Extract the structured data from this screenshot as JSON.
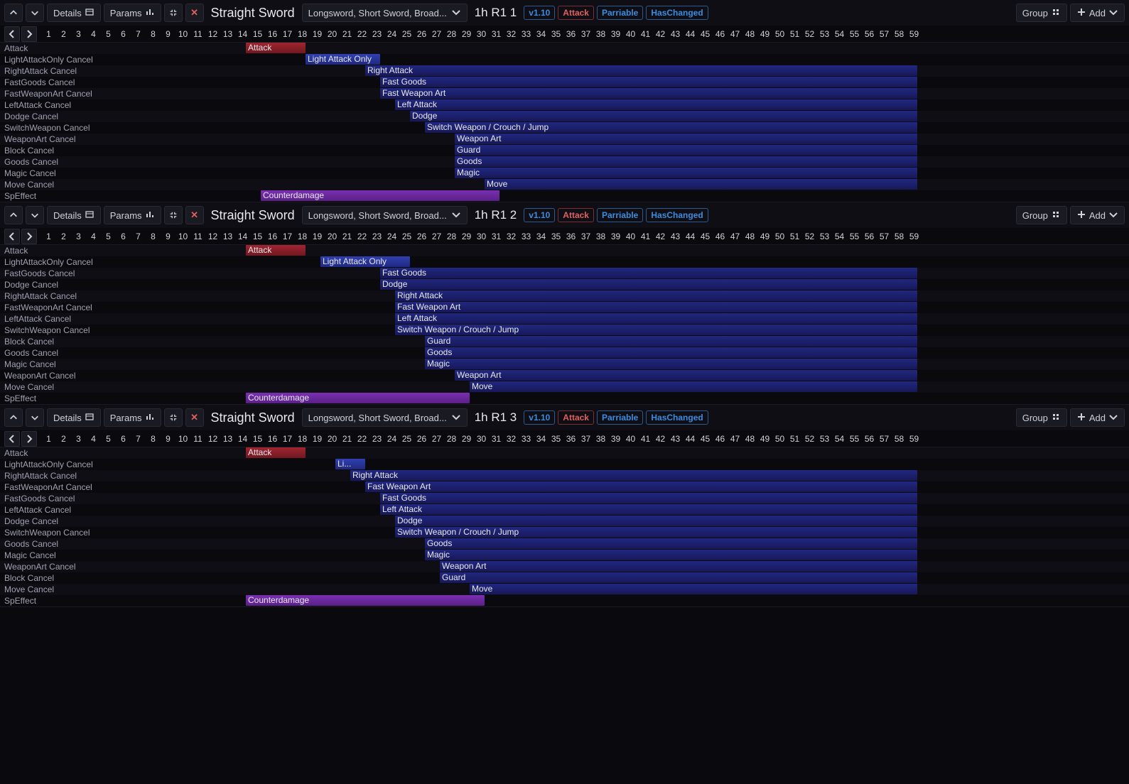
{
  "common": {
    "details_label": "Details",
    "params_label": "Params",
    "group_label": "Group",
    "add_label": "Add",
    "weapon_category": "Straight Sword",
    "weapon_list": "Longsword, Short Sword, Broad...",
    "version_tag": "v1.10",
    "attack_tag": "Attack",
    "parriable_tag": "Parriable",
    "changed_tag": "HasChanged"
  },
  "chart_data": [
    {
      "type": "bar",
      "title": "1h R1 1",
      "x_range": [
        1,
        59
      ],
      "tracks": [
        {
          "label": "Attack",
          "start": 15,
          "end": 18,
          "text": "Attack",
          "color": "red"
        },
        {
          "label": "LightAttackOnly Cancel",
          "start": 19,
          "end": 23,
          "text": "Light Attack Only",
          "color": "blue-light"
        },
        {
          "label": "RightAttack Cancel",
          "start": 23,
          "end": 59,
          "text": "Right Attack",
          "color": "blue"
        },
        {
          "label": "FastGoods Cancel",
          "start": 24,
          "end": 59,
          "text": "Fast Goods",
          "color": "blue"
        },
        {
          "label": "FastWeaponArt Cancel",
          "start": 24,
          "end": 59,
          "text": "Fast Weapon Art",
          "color": "blue"
        },
        {
          "label": "LeftAttack Cancel",
          "start": 25,
          "end": 59,
          "text": "Left Attack",
          "color": "blue"
        },
        {
          "label": "Dodge Cancel",
          "start": 26,
          "end": 59,
          "text": "Dodge",
          "color": "blue"
        },
        {
          "label": "SwitchWeapon Cancel",
          "start": 27,
          "end": 59,
          "text": "Switch Weapon / Crouch / Jump",
          "color": "blue"
        },
        {
          "label": "WeaponArt Cancel",
          "start": 29,
          "end": 59,
          "text": "Weapon Art",
          "color": "blue"
        },
        {
          "label": "Block Cancel",
          "start": 29,
          "end": 59,
          "text": "Guard",
          "color": "blue"
        },
        {
          "label": "Goods Cancel",
          "start": 29,
          "end": 59,
          "text": "Goods",
          "color": "blue"
        },
        {
          "label": "Magic Cancel",
          "start": 29,
          "end": 59,
          "text": "Magic",
          "color": "blue"
        },
        {
          "label": "Move Cancel",
          "start": 31,
          "end": 59,
          "text": "Move",
          "color": "blue"
        },
        {
          "label": "SpEffect",
          "start": 16,
          "end": 31,
          "text": "Counterdamage",
          "color": "purple"
        }
      ]
    },
    {
      "type": "bar",
      "title": "1h R1 2",
      "x_range": [
        1,
        59
      ],
      "tracks": [
        {
          "label": "Attack",
          "start": 15,
          "end": 18,
          "text": "Attack",
          "color": "red"
        },
        {
          "label": "LightAttackOnly Cancel",
          "start": 20,
          "end": 25,
          "text": "Light Attack Only",
          "color": "blue-light"
        },
        {
          "label": "FastGoods Cancel",
          "start": 24,
          "end": 59,
          "text": "Fast Goods",
          "color": "blue"
        },
        {
          "label": "Dodge Cancel",
          "start": 24,
          "end": 59,
          "text": "Dodge",
          "color": "blue"
        },
        {
          "label": "RightAttack Cancel",
          "start": 25,
          "end": 59,
          "text": "Right Attack",
          "color": "blue"
        },
        {
          "label": "FastWeaponArt Cancel",
          "start": 25,
          "end": 59,
          "text": "Fast Weapon Art",
          "color": "blue"
        },
        {
          "label": "LeftAttack Cancel",
          "start": 25,
          "end": 59,
          "text": "Left Attack",
          "color": "blue"
        },
        {
          "label": "SwitchWeapon Cancel",
          "start": 25,
          "end": 59,
          "text": "Switch Weapon / Crouch / Jump",
          "color": "blue"
        },
        {
          "label": "Block Cancel",
          "start": 27,
          "end": 59,
          "text": "Guard",
          "color": "blue"
        },
        {
          "label": "Goods Cancel",
          "start": 27,
          "end": 59,
          "text": "Goods",
          "color": "blue"
        },
        {
          "label": "Magic Cancel",
          "start": 27,
          "end": 59,
          "text": "Magic",
          "color": "blue"
        },
        {
          "label": "WeaponArt Cancel",
          "start": 29,
          "end": 59,
          "text": "Weapon Art",
          "color": "blue"
        },
        {
          "label": "Move Cancel",
          "start": 30,
          "end": 59,
          "text": "Move",
          "color": "blue"
        },
        {
          "label": "SpEffect",
          "start": 15,
          "end": 29,
          "text": "Counterdamage",
          "color": "purple"
        }
      ]
    },
    {
      "type": "bar",
      "title": "1h R1 3",
      "x_range": [
        1,
        59
      ],
      "tracks": [
        {
          "label": "Attack",
          "start": 15,
          "end": 18,
          "text": "Attack",
          "color": "red"
        },
        {
          "label": "LightAttackOnly Cancel",
          "start": 21,
          "end": 22,
          "text": "Li...",
          "color": "blue-light"
        },
        {
          "label": "RightAttack Cancel",
          "start": 22,
          "end": 59,
          "text": "Right Attack",
          "color": "blue"
        },
        {
          "label": "FastWeaponArt Cancel",
          "start": 23,
          "end": 59,
          "text": "Fast Weapon Art",
          "color": "blue"
        },
        {
          "label": "FastGoods Cancel",
          "start": 24,
          "end": 59,
          "text": "Fast Goods",
          "color": "blue"
        },
        {
          "label": "LeftAttack Cancel",
          "start": 24,
          "end": 59,
          "text": "Left Attack",
          "color": "blue"
        },
        {
          "label": "Dodge Cancel",
          "start": 25,
          "end": 59,
          "text": "Dodge",
          "color": "blue"
        },
        {
          "label": "SwitchWeapon Cancel",
          "start": 25,
          "end": 59,
          "text": "Switch Weapon / Crouch / Jump",
          "color": "blue"
        },
        {
          "label": "Goods Cancel",
          "start": 27,
          "end": 59,
          "text": "Goods",
          "color": "blue"
        },
        {
          "label": "Magic Cancel",
          "start": 27,
          "end": 59,
          "text": "Magic",
          "color": "blue"
        },
        {
          "label": "WeaponArt Cancel",
          "start": 28,
          "end": 59,
          "text": "Weapon Art",
          "color": "blue"
        },
        {
          "label": "Block Cancel",
          "start": 28,
          "end": 59,
          "text": "Guard",
          "color": "blue"
        },
        {
          "label": "Move Cancel",
          "start": 30,
          "end": 59,
          "text": "Move",
          "color": "blue"
        },
        {
          "label": "SpEffect",
          "start": 15,
          "end": 30,
          "text": "Counterdamage",
          "color": "purple"
        }
      ]
    }
  ]
}
